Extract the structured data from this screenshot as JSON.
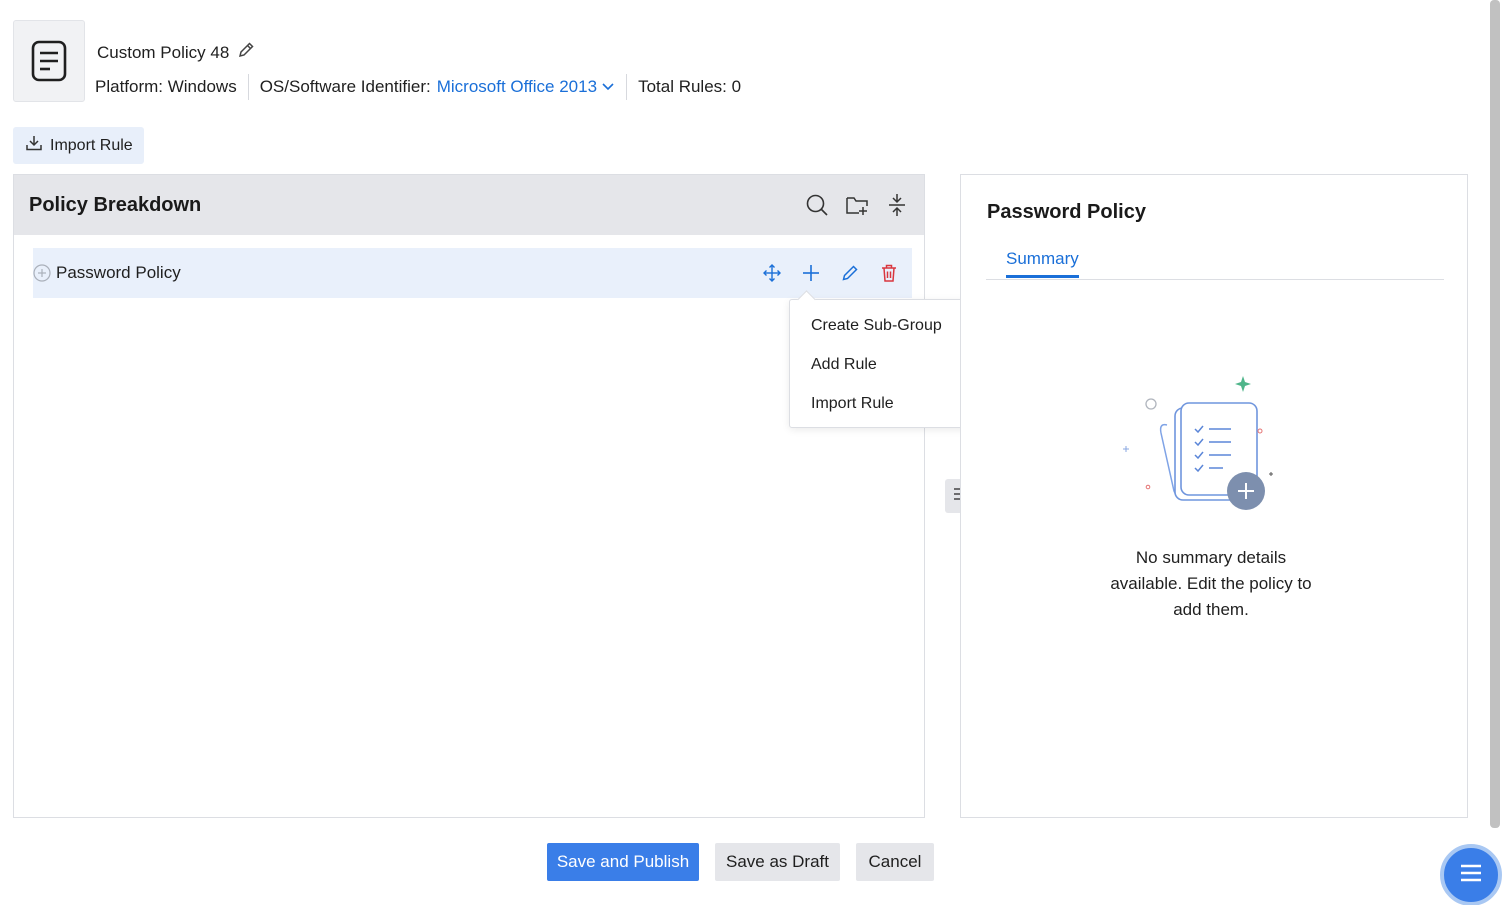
{
  "header": {
    "policy_name": "Custom Policy 48",
    "platform_label": "Platform: Windows",
    "identifier_label": "OS/Software Identifier:",
    "identifier_value": "Microsoft Office 2013",
    "total_rules": "Total Rules: 0"
  },
  "toolbar": {
    "import_rule_label": "Import Rule"
  },
  "policy_breakdown": {
    "title": "Policy Breakdown",
    "tree": [
      {
        "label": "Password Policy"
      }
    ]
  },
  "add_menu": {
    "items": [
      {
        "label": "Create Sub-Group"
      },
      {
        "label": "Add Rule"
      },
      {
        "label": "Import Rule"
      }
    ]
  },
  "detail_panel": {
    "title": "Password Policy",
    "tabs": [
      {
        "label": "Summary"
      }
    ],
    "empty_message": "No summary details available. Edit the policy to add them."
  },
  "footer": {
    "save_publish_label": "Save and Publish",
    "save_draft_label": "Save as Draft",
    "cancel_label": "Cancel"
  },
  "colors": {
    "accent": "#1a6fd8",
    "primary_button": "#3a7ee8",
    "delete": "#d9363e",
    "panel_header": "#e5e6ea",
    "row_highlight": "#e9f0fb"
  }
}
